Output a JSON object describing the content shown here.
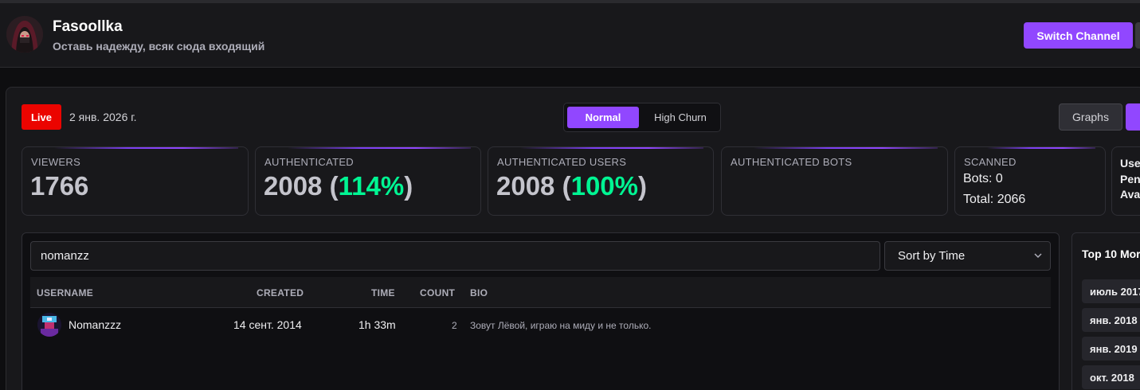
{
  "channel": {
    "name": "Fasoollka",
    "description": "Оставь надежду, всяк сюда входящий",
    "switch_label": "Switch Channel"
  },
  "status": {
    "live_label": "Live",
    "date": "2 янв. 2026 г."
  },
  "mode_toggle": {
    "options": [
      "Normal",
      "High Churn"
    ],
    "selected": "Normal"
  },
  "toolbar": {
    "graphs_label": "Graphs"
  },
  "stats": {
    "viewers": {
      "label": "VIEWERS",
      "value": "1766"
    },
    "authenticated": {
      "label": "AUTHENTICATED",
      "value": "2008",
      "percent": "114%"
    },
    "authenticated_users": {
      "label": "AUTHENTICATED USERS",
      "value": "2008",
      "percent": "100%"
    },
    "authenticated_bots": {
      "label": "AUTHENTICATED BOTS"
    },
    "scanned": {
      "label": "SCANNED",
      "bots": "Bots: 0",
      "total": "Total: 2066"
    },
    "partial": {
      "line1": "Use",
      "line2": "Pen",
      "line3": "Ava"
    }
  },
  "search": {
    "value": "nomanzz",
    "sort_selected": "Sort by Time"
  },
  "table": {
    "columns": [
      "USERNAME",
      "CREATED",
      "TIME",
      "COUNT",
      "BIO"
    ],
    "rows": [
      {
        "username": "Nomanzzz",
        "created": "14 сент. 2014",
        "time": "1h 33m",
        "count": "2",
        "bio": "Зовут Лёвой, играю на миду и не только."
      }
    ]
  },
  "side_panel": {
    "title": "Top 10 Mor",
    "items": [
      "июль 2017",
      "янв. 2018",
      "янв. 2019",
      "окт. 2018"
    ]
  },
  "colors": {
    "accent": "#9147ff",
    "live": "#eb0400",
    "positive": "#00f593"
  }
}
